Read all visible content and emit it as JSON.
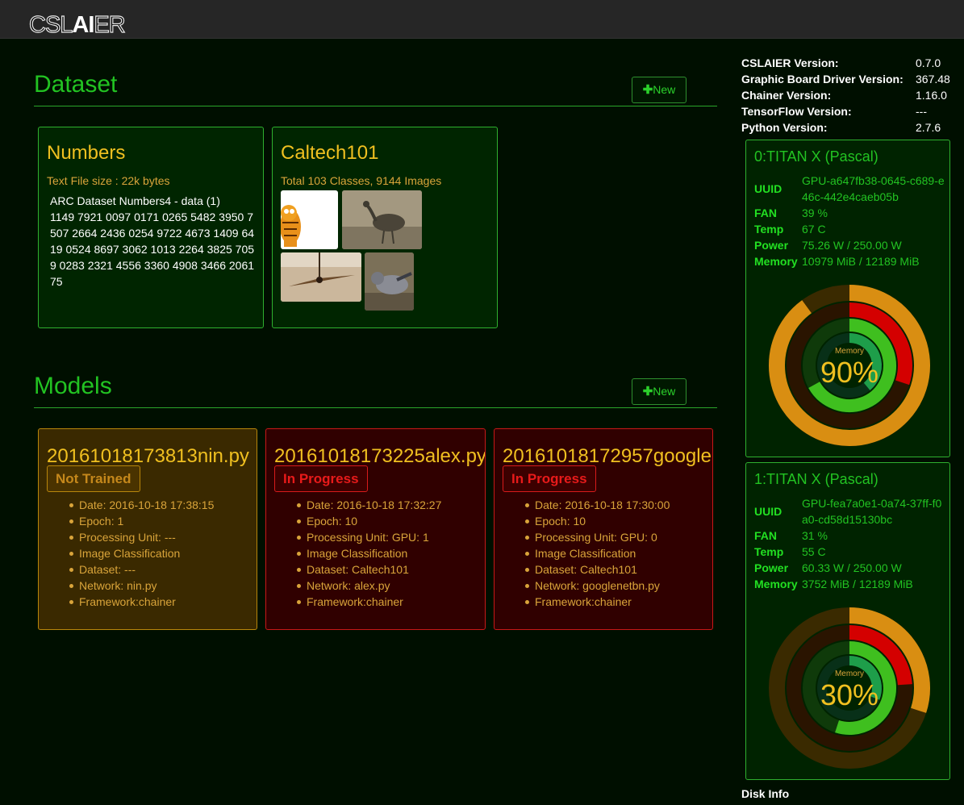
{
  "app": {
    "logo_prefix": "CSL",
    "logo_highlight": "AI",
    "logo_suffix": "ER"
  },
  "dataset_section": {
    "title": "Dataset",
    "new_button": "New"
  },
  "datasets": [
    {
      "name": "Numbers",
      "subtitle": "Text File size : 22k bytes",
      "content": "ARC Dataset Numbers4 - data (1)\n1149 7921 0097 0171 0265 5482 3950 7507 2664 2436 0254 9722 4673 1409 6419 0524 8697 3062 1013 2264 3825 7059 0283 2321 4556 3360 4908 3466 2061 75"
    },
    {
      "name": "Caltech101",
      "subtitle": "Total 103 Classes, 9144 Images",
      "thumbnails": [
        "garfield",
        "emu",
        "ceiling-fan",
        "pigeon"
      ]
    }
  ],
  "models_section": {
    "title": "Models",
    "new_button": "New"
  },
  "models": [
    {
      "name": "20161018173813nin.py",
      "status": "Not Trained",
      "details": [
        "Date: 2016-10-18 17:38:15",
        "Epoch: 1",
        "Processing Unit: ---",
        "Image Classification",
        "Dataset: ---",
        "Network: nin.py",
        "Framework:chainer"
      ]
    },
    {
      "name": "20161018173225alex.py",
      "status": "In Progress",
      "details": [
        "Date: 2016-10-18 17:32:27",
        "Epoch: 10",
        "Processing Unit: GPU: 1",
        "Image Classification",
        "Dataset: Caltech101",
        "Network: alex.py",
        "Framework:chainer"
      ]
    },
    {
      "name": "20161018172957googlenetbn.py",
      "status": "In Progress",
      "details": [
        "Date: 2016-10-18 17:30:00",
        "Epoch: 10",
        "Processing Unit: GPU: 0",
        "Image Classification",
        "Dataset: Caltech101",
        "Network: googlenetbn.py",
        "Framework:chainer"
      ]
    }
  ],
  "versions": [
    {
      "label": "CSLAIER Version:",
      "value": "0.7.0"
    },
    {
      "label": "Graphic Board Driver Version:",
      "value": "367.48"
    },
    {
      "label": "Chainer Version:",
      "value": "1.16.0"
    },
    {
      "label": "TensorFlow Version:",
      "value": "---"
    },
    {
      "label": "Python Version:",
      "value": "2.7.6"
    }
  ],
  "gpus": [
    {
      "title": "0:TITAN X (Pascal)",
      "uuid_label": "UUID",
      "uuid": "GPU-a647fb38-0645-c689-e46c-442e4caeb05b",
      "fan_label": "FAN",
      "fan": "39 %",
      "temp_label": "Temp",
      "temp": "67 C",
      "power_label": "Power",
      "power": "75.26 W / 250.00 W",
      "memory_label": "Memory",
      "memory": "10979 MiB / 12189 MiB",
      "chart_label": "Memory",
      "chart_percent": "90%",
      "memory_fraction": 0.9,
      "temp_fraction": 0.67,
      "power_fraction": 0.3,
      "fan_fraction": 0.39
    },
    {
      "title": "1:TITAN X (Pascal)",
      "uuid_label": "UUID",
      "uuid": "GPU-fea7a0e1-0a74-37ff-f0a0-cd58d15130bc",
      "fan_label": "FAN",
      "fan": "31 %",
      "temp_label": "Temp",
      "temp": "55 C",
      "power_label": "Power",
      "power": "60.33 W / 250.00 W",
      "memory_label": "Memory",
      "memory": "3752 MiB / 12189 MiB",
      "chart_label": "Memory",
      "chart_percent": "30%",
      "memory_fraction": 0.3,
      "temp_fraction": 0.55,
      "power_fraction": 0.24,
      "fan_fraction": 0.31
    }
  ],
  "disk_info": {
    "title": "Disk Info"
  },
  "colors": {
    "accent_green": "#22c322",
    "gold": "#f0c020",
    "orange": "#d98e12",
    "red": "#d40000"
  }
}
